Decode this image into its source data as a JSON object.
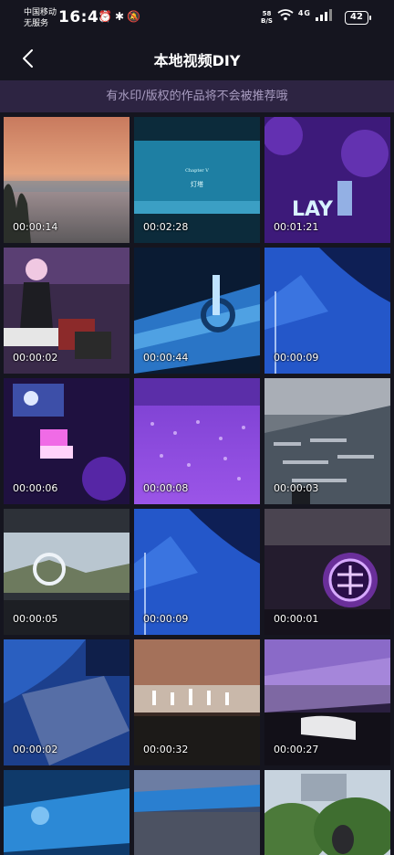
{
  "status_bar": {
    "carrier_1": "中国移动",
    "carrier_2": "无服务",
    "time": "16:48",
    "net_speed_value": "58",
    "net_speed_unit": "B/S",
    "signal_label": "4G",
    "battery": "42"
  },
  "header": {
    "title": "本地视频DIY"
  },
  "notice": "有水印/版权的作品将不会被推荐哦",
  "videos": [
    {
      "duration": "00:00:14",
      "thumb": "sunset-beach"
    },
    {
      "duration": "00:02:28",
      "thumb": "blue-screen-text",
      "caption_line1": "Chapter V",
      "caption_line2": "灯塔"
    },
    {
      "duration": "00:01:21",
      "thumb": "purple-concert-lay",
      "sign_text": "LAY"
    },
    {
      "duration": "00:00:02",
      "thumb": "performer-keyboard"
    },
    {
      "duration": "00:00:44",
      "thumb": "blue-stage-logo"
    },
    {
      "duration": "00:00:09",
      "thumb": "blue-blur"
    },
    {
      "duration": "00:00:06",
      "thumb": "purple-stage-cube"
    },
    {
      "duration": "00:00:08",
      "thumb": "purple-lightsticks"
    },
    {
      "duration": "00:00:03",
      "thumb": "stadium-crowd"
    },
    {
      "duration": "00:00:05",
      "thumb": "stadium-cube-screen"
    },
    {
      "duration": "00:00:09",
      "thumb": "blue-blur-2"
    },
    {
      "duration": "00:00:01",
      "thumb": "glowing-logo"
    },
    {
      "duration": "00:00:02",
      "thumb": "blue-blur-3"
    },
    {
      "duration": "00:00:32",
      "thumb": "stage-performers"
    },
    {
      "duration": "00:00:27",
      "thumb": "purple-arena"
    },
    {
      "duration": "",
      "thumb": "blue-stage-partial"
    },
    {
      "duration": "",
      "thumb": "stadium-partial"
    },
    {
      "duration": "",
      "thumb": "building-trees"
    }
  ],
  "colors": {
    "background": "#15151f",
    "notice_bg": "#2d2442",
    "notice_text": "#a89cc0"
  }
}
